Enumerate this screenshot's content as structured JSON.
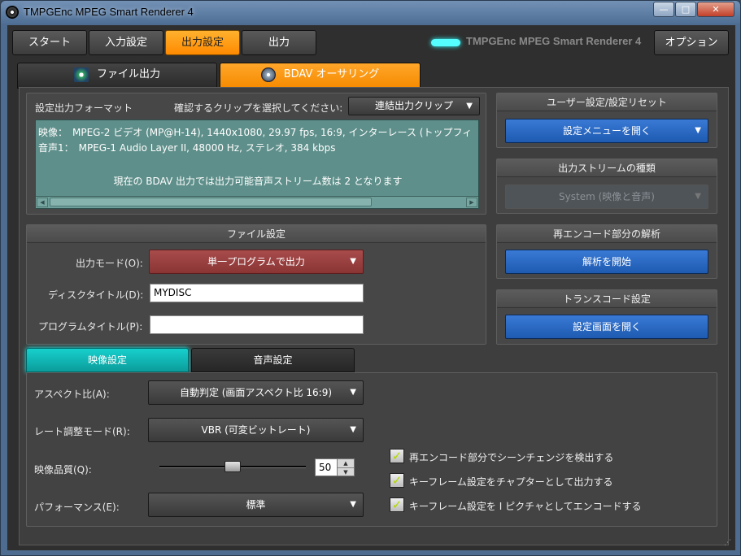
{
  "window": {
    "title": "TMPGEnc MPEG Smart Renderer 4",
    "minimize": "—",
    "maximize": "□",
    "close": "✕"
  },
  "nav": {
    "start": "スタート",
    "input_settings": "入力設定",
    "output_settings": "出力設定",
    "output": "出力",
    "brand": "TMPGEnc MPEG Smart Renderer 4",
    "options": "オプション"
  },
  "main_tabs": {
    "file_output": "ファイル出力",
    "bdav_authoring": "BDAV オーサリング"
  },
  "format": {
    "label": "設定出力フォーマット",
    "clip_prompt": "確認するクリップを選択してください:",
    "clip_selected": "連結出力クリップ",
    "video_line": "映像：　MPEG-2 ビデオ (MP@H-14), 1440x1080, 29.97 fps, 16:9, インターレース (トップフィ",
    "audio_line": "音声1：　MPEG-1 Audio Layer II, 48000 Hz, ステレオ, 384 kbps",
    "note": "現在の BDAV 出力では出力可能音声ストリーム数は 2 となります"
  },
  "file_settings": {
    "header": "ファイル設定",
    "output_mode_label": "出力モード(O):",
    "output_mode_value": "単一プログラムで出力",
    "disc_title_label": "ディスクタイトル(D):",
    "disc_title_value": "MYDISC",
    "program_title_label": "プログラムタイトル(P):",
    "program_title_value": ""
  },
  "right_panels": {
    "user_settings_header": "ユーザー設定/設定リセット",
    "user_settings_button": "設定メニューを開く",
    "stream_type_header": "出力ストリームの種類",
    "stream_type_value": "System (映像と音声)",
    "reencode_header": "再エンコード部分の解析",
    "reencode_button": "解析を開始",
    "transcode_header": "トランスコード設定",
    "transcode_button": "設定画面を開く"
  },
  "sub_tabs": {
    "video": "映像設定",
    "audio": "音声設定"
  },
  "video_settings": {
    "aspect_label": "アスペクト比(A):",
    "aspect_value": "自動判定 (画面アスペクト比 16:9)",
    "rate_mode_label": "レート調整モード(R):",
    "rate_mode_value": "VBR (可変ビットレート)",
    "quality_label": "映像品質(Q):",
    "quality_value": "50",
    "quality_fraction": 0.5,
    "performance_label": "パフォーマンス(E):",
    "performance_value": "標準",
    "check_scene_change": "再エンコード部分でシーンチェンジを検出する",
    "check_keyframe_chapter": "キーフレーム設定をチャプターとして出力する",
    "check_keyframe_ipicture": "キーフレーム設定を I ピクチャとしてエンコードする"
  },
  "icons": {
    "caret": "▼",
    "check": "✓",
    "spin_up": "▲",
    "spin_down": "▼",
    "scroll_left": "◀",
    "scroll_right": "▶",
    "grip": "⋰"
  }
}
